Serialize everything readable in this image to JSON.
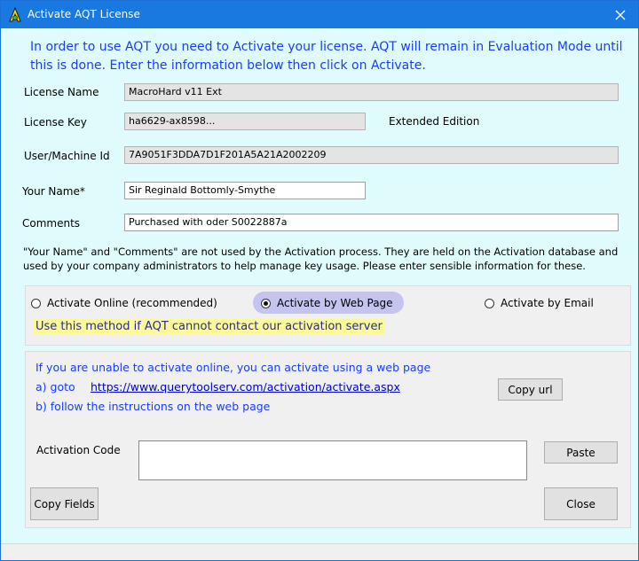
{
  "window": {
    "title": "Activate AQT License",
    "close_icon": "close-icon",
    "app_icon": "aqt-icon"
  },
  "intro": "In order to use AQT you need to Activate your license. AQT will remain in Evaluation Mode until this is done. Enter the information below then click on Activate.",
  "form": {
    "license_name_label": "License Name",
    "license_name_value": "MacroHard v11 Ext",
    "license_key_label": "License Key",
    "license_key_value": "ha6629-ax8598...",
    "edition": "Extended Edition",
    "machine_id_label": "User/Machine Id",
    "machine_id_value": "7A9051F3DDA7D1F201A5A21A2002209",
    "your_name_label": "Your Name*",
    "your_name_value": "Sir Reginald Bottomly-Smythe",
    "comments_label": "Comments",
    "comments_value": "Purchased with oder S0022887a"
  },
  "note": "\"Your Name\" and \"Comments\" are not used by the Activation process. They are held on the Activation database and used by your company administrators to help manage key usage. Please enter sensible information for these.",
  "methods": {
    "online": "Activate Online (recommended)",
    "web": "Activate by Web Page",
    "email": "Activate by Email",
    "selected": "web",
    "hint": "Use this method if AQT cannot contact our activation server"
  },
  "web_page": {
    "line1": "If you are unable to activate online, you can activate using a web page",
    "step_a": "a) goto",
    "url": "https://www.querytoolserv.com/activation/activate.aspx",
    "step_b": "b) follow the instructions on the web page",
    "copy_url": "Copy url",
    "activation_code_label": "Activation Code",
    "activation_code_value": "",
    "paste": "Paste"
  },
  "buttons": {
    "copy_fields": "Copy Fields",
    "close": "Close"
  },
  "colors": {
    "title_bar": "#1979e0",
    "window_bg": "#e0fbfb",
    "link_text": "#1a3cff",
    "hint_bg": "#fbf99a",
    "selected_pill": "#c4c4ee"
  }
}
